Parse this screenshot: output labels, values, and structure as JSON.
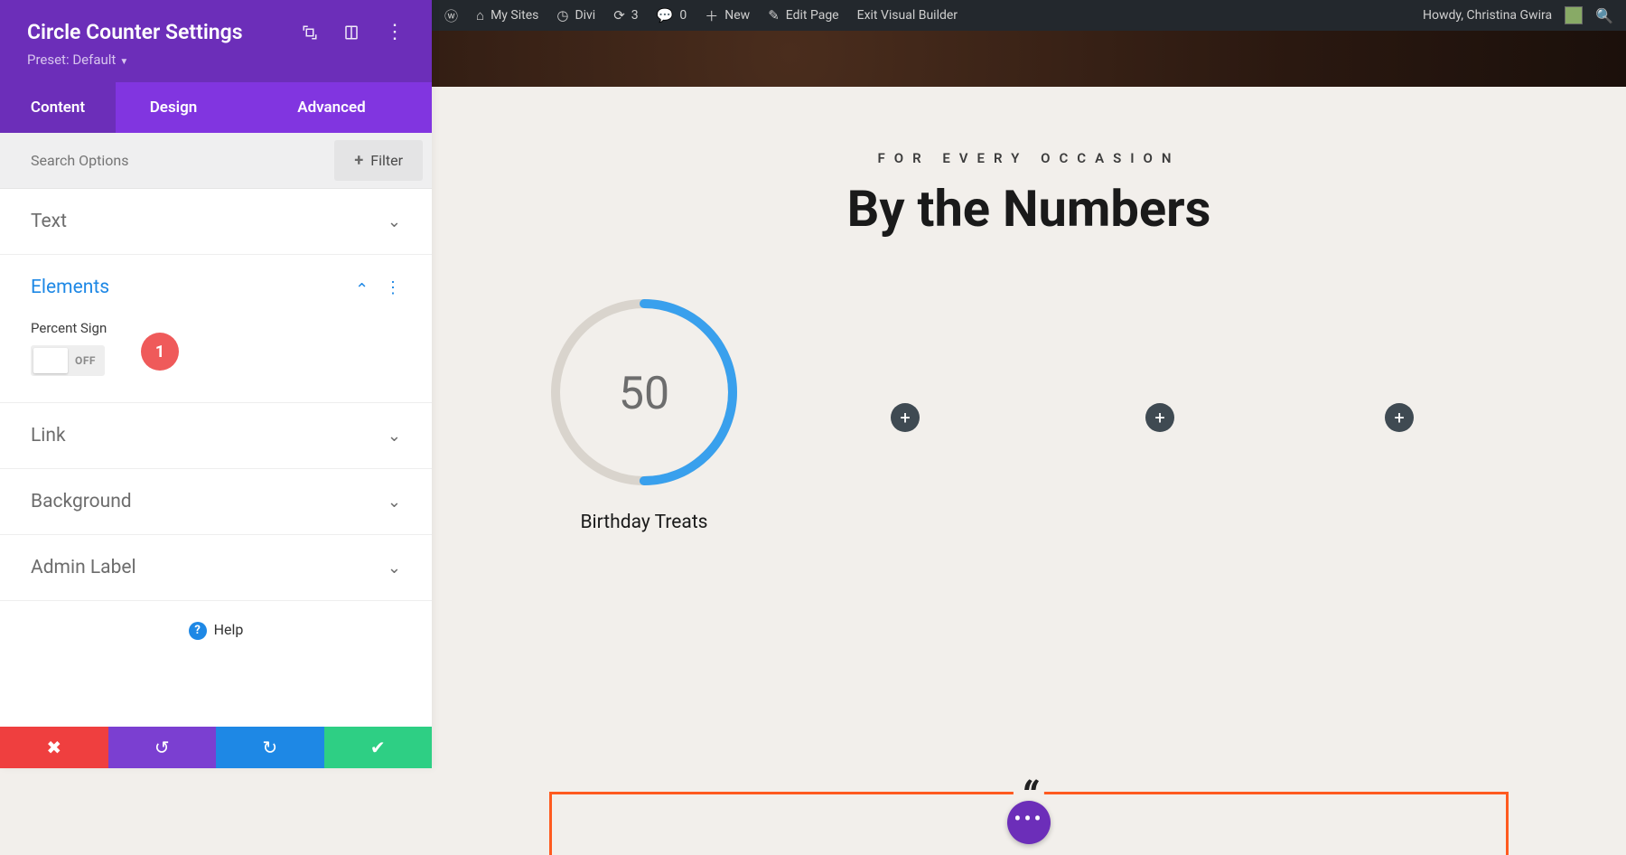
{
  "panel": {
    "title": "Circle Counter Settings",
    "preset_label": "Preset: Default",
    "tabs": [
      "Content",
      "Design",
      "Advanced"
    ],
    "search_placeholder": "Search Options",
    "filter_label": "Filter",
    "sections": {
      "text": "Text",
      "elements": "Elements",
      "link": "Link",
      "background": "Background",
      "admin_label": "Admin Label"
    },
    "elements": {
      "percent_sign_label": "Percent Sign",
      "percent_sign_state": "OFF"
    },
    "annotation_badge": "1",
    "help_label": "Help"
  },
  "wpbar": {
    "my_sites": "My Sites",
    "divi": "Divi",
    "refresh_count": "3",
    "comments_count": "0",
    "new": "New",
    "edit_page": "Edit Page",
    "exit_builder": "Exit Visual Builder",
    "howdy": "Howdy, Christina Gwira"
  },
  "page": {
    "eyebrow": "FOR EVERY OCCASION",
    "headline": "By the Numbers",
    "counter": {
      "value": "50",
      "label": "Birthday Treats",
      "percent": 50
    }
  },
  "colors": {
    "accent": "#6c2eb9",
    "accent_light": "#8135e0",
    "ring": "#39a0ed",
    "orange": "#ff5a1f"
  }
}
